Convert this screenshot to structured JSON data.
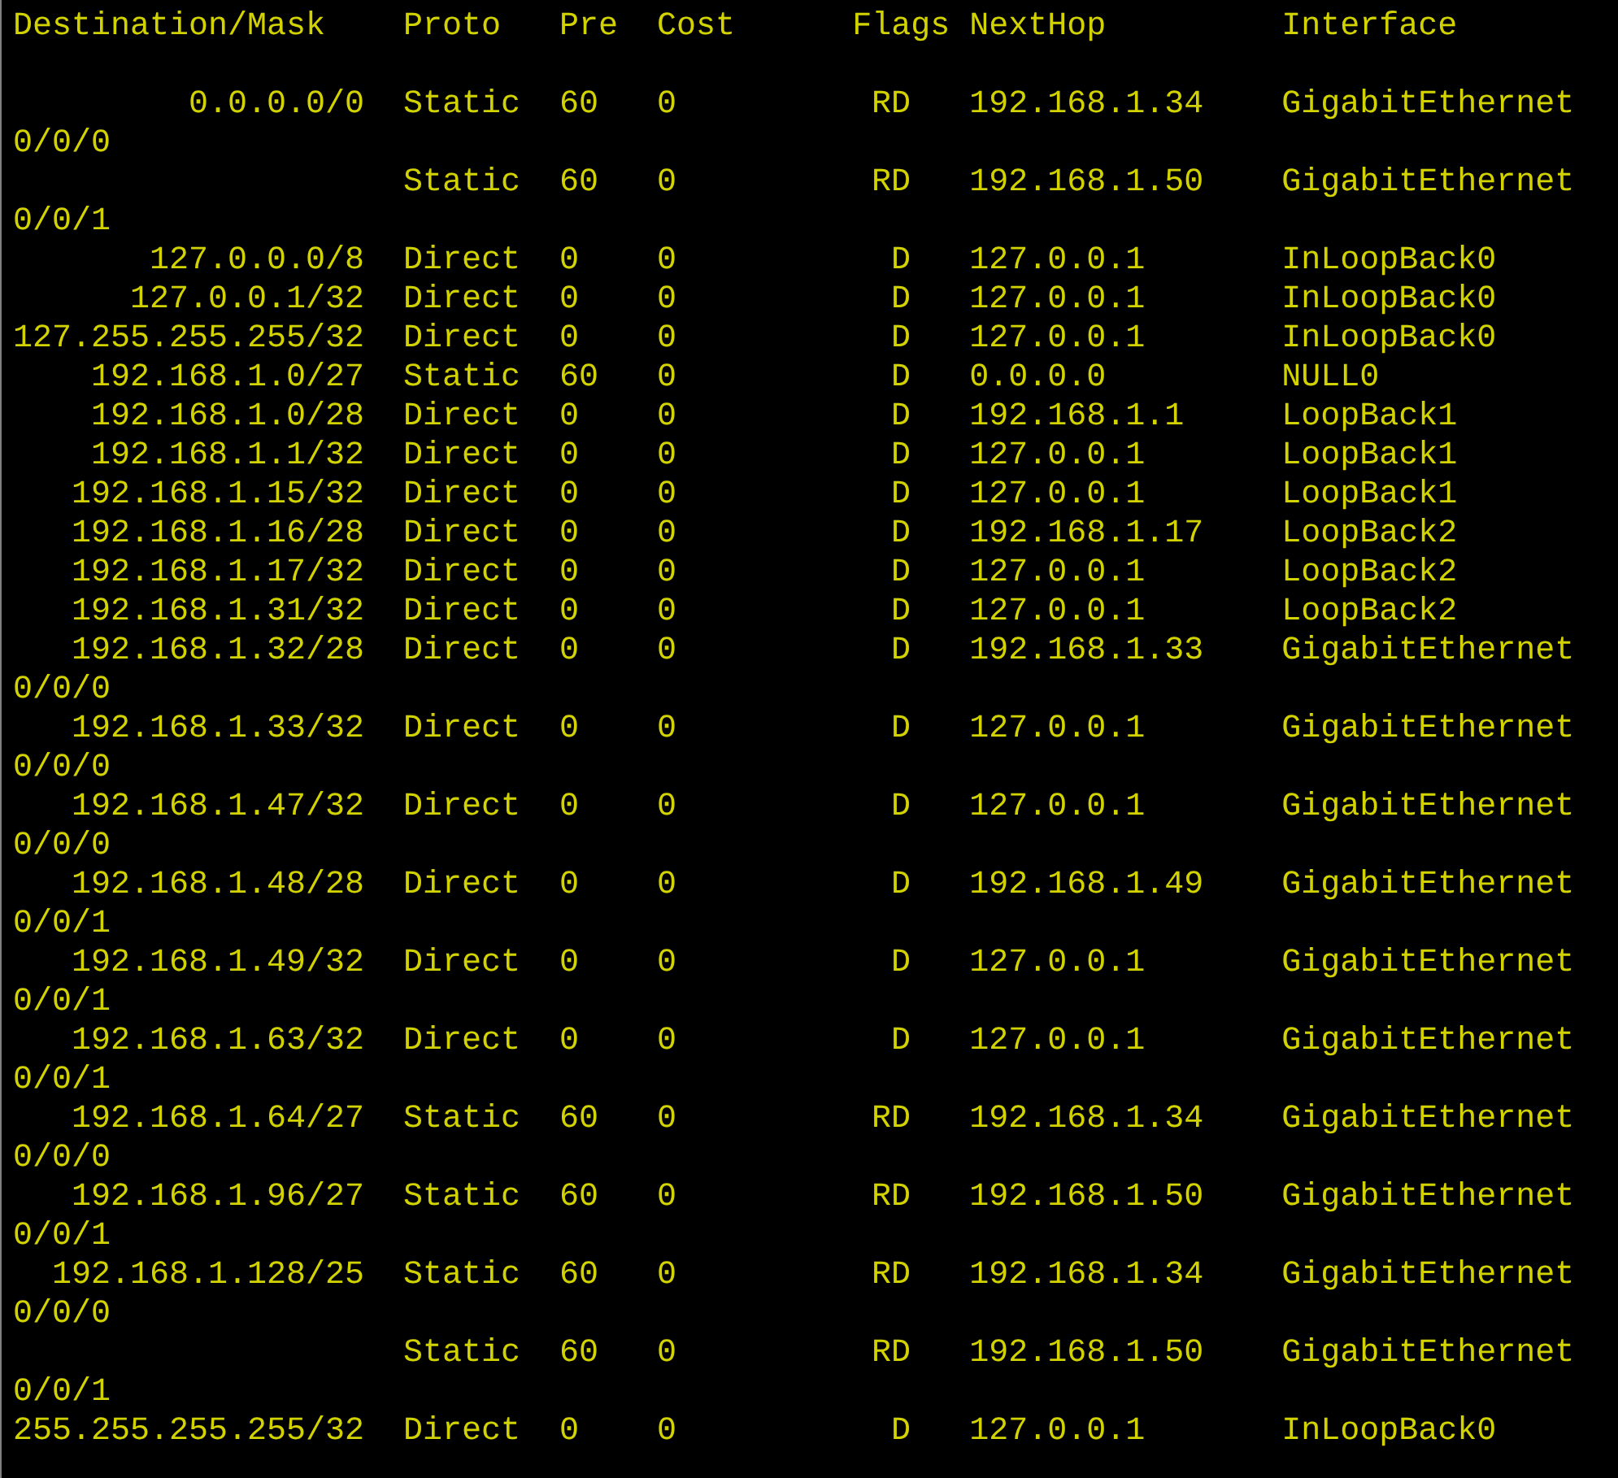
{
  "table": {
    "columns": [
      "Destination/Mask",
      "Proto",
      "Pre",
      "Cost",
      "Flags",
      "NextHop",
      "Interface"
    ],
    "rows": [
      {
        "destination": "0.0.0.0/0",
        "proto": "Static",
        "pre": "60",
        "cost": "0",
        "flags": "RD",
        "nexthop": "192.168.1.34",
        "interface": "GigabitEthernet",
        "interface_cont": "0/0/0"
      },
      {
        "proto": "Static",
        "pre": "60",
        "cost": "0",
        "flags": "RD",
        "nexthop": "192.168.1.50",
        "interface": "GigabitEthernet",
        "interface_cont": "0/0/1"
      },
      {
        "destination": "127.0.0.0/8",
        "proto": "Direct",
        "pre": "0",
        "cost": "0",
        "flags": "D",
        "nexthop": "127.0.0.1",
        "interface": "InLoopBack0"
      },
      {
        "destination": "127.0.0.1/32",
        "proto": "Direct",
        "pre": "0",
        "cost": "0",
        "flags": "D",
        "nexthop": "127.0.0.1",
        "interface": "InLoopBack0"
      },
      {
        "destination": "127.255.255.255/32",
        "proto": "Direct",
        "pre": "0",
        "cost": "0",
        "flags": "D",
        "nexthop": "127.0.0.1",
        "interface": "InLoopBack0"
      },
      {
        "destination": "192.168.1.0/27",
        "proto": "Static",
        "pre": "60",
        "cost": "0",
        "flags": "D",
        "nexthop": "0.0.0.0",
        "interface": "NULL0"
      },
      {
        "destination": "192.168.1.0/28",
        "proto": "Direct",
        "pre": "0",
        "cost": "0",
        "flags": "D",
        "nexthop": "192.168.1.1",
        "interface": "LoopBack1"
      },
      {
        "destination": "192.168.1.1/32",
        "proto": "Direct",
        "pre": "0",
        "cost": "0",
        "flags": "D",
        "nexthop": "127.0.0.1",
        "interface": "LoopBack1"
      },
      {
        "destination": "192.168.1.15/32",
        "proto": "Direct",
        "pre": "0",
        "cost": "0",
        "flags": "D",
        "nexthop": "127.0.0.1",
        "interface": "LoopBack1"
      },
      {
        "destination": "192.168.1.16/28",
        "proto": "Direct",
        "pre": "0",
        "cost": "0",
        "flags": "D",
        "nexthop": "192.168.1.17",
        "interface": "LoopBack2"
      },
      {
        "destination": "192.168.1.17/32",
        "proto": "Direct",
        "pre": "0",
        "cost": "0",
        "flags": "D",
        "nexthop": "127.0.0.1",
        "interface": "LoopBack2"
      },
      {
        "destination": "192.168.1.31/32",
        "proto": "Direct",
        "pre": "0",
        "cost": "0",
        "flags": "D",
        "nexthop": "127.0.0.1",
        "interface": "LoopBack2"
      },
      {
        "destination": "192.168.1.32/28",
        "proto": "Direct",
        "pre": "0",
        "cost": "0",
        "flags": "D",
        "nexthop": "192.168.1.33",
        "interface": "GigabitEthernet",
        "interface_cont": "0/0/0"
      },
      {
        "destination": "192.168.1.33/32",
        "proto": "Direct",
        "pre": "0",
        "cost": "0",
        "flags": "D",
        "nexthop": "127.0.0.1",
        "interface": "GigabitEthernet",
        "interface_cont": "0/0/0"
      },
      {
        "destination": "192.168.1.47/32",
        "proto": "Direct",
        "pre": "0",
        "cost": "0",
        "flags": "D",
        "nexthop": "127.0.0.1",
        "interface": "GigabitEthernet",
        "interface_cont": "0/0/0"
      },
      {
        "destination": "192.168.1.48/28",
        "proto": "Direct",
        "pre": "0",
        "cost": "0",
        "flags": "D",
        "nexthop": "192.168.1.49",
        "interface": "GigabitEthernet",
        "interface_cont": "0/0/1"
      },
      {
        "destination": "192.168.1.49/32",
        "proto": "Direct",
        "pre": "0",
        "cost": "0",
        "flags": "D",
        "nexthop": "127.0.0.1",
        "interface": "GigabitEthernet",
        "interface_cont": "0/0/1"
      },
      {
        "destination": "192.168.1.63/32",
        "proto": "Direct",
        "pre": "0",
        "cost": "0",
        "flags": "D",
        "nexthop": "127.0.0.1",
        "interface": "GigabitEthernet",
        "interface_cont": "0/0/1"
      },
      {
        "destination": "192.168.1.64/27",
        "proto": "Static",
        "pre": "60",
        "cost": "0",
        "flags": "RD",
        "nexthop": "192.168.1.34",
        "interface": "GigabitEthernet",
        "interface_cont": "0/0/0"
      },
      {
        "destination": "192.168.1.96/27",
        "proto": "Static",
        "pre": "60",
        "cost": "0",
        "flags": "RD",
        "nexthop": "192.168.1.50",
        "interface": "GigabitEthernet",
        "interface_cont": "0/0/1"
      },
      {
        "destination": "192.168.1.128/25",
        "proto": "Static",
        "pre": "60",
        "cost": "0",
        "flags": "RD",
        "nexthop": "192.168.1.34",
        "interface": "GigabitEthernet",
        "interface_cont": "0/0/0"
      },
      {
        "proto": "Static",
        "pre": "60",
        "cost": "0",
        "flags": "RD",
        "nexthop": "192.168.1.50",
        "interface": "GigabitEthernet",
        "interface_cont": "0/0/1"
      },
      {
        "destination": "255.255.255.255/32",
        "proto": "Direct",
        "pre": "0",
        "cost": "0",
        "flags": "D",
        "nexthop": "127.0.0.1",
        "interface": "InLoopBack0"
      }
    ]
  }
}
